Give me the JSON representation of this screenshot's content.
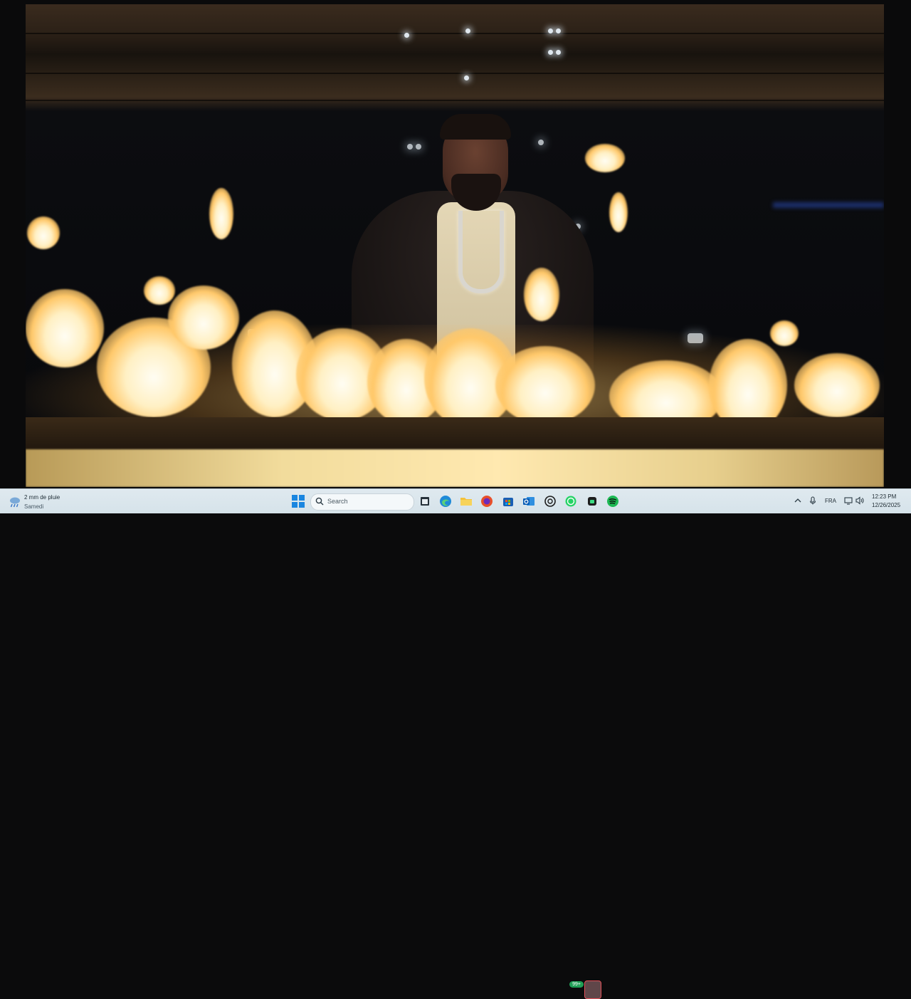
{
  "taskbar": {
    "weather": {
      "icon": "weather-rain-icon",
      "line1": "2 mm de pluie",
      "line2": "Samedi"
    },
    "search": {
      "placeholder": "Search"
    },
    "pinned_apps": [
      {
        "name": "file-explorer-icon"
      },
      {
        "name": "edge-browser-icon"
      },
      {
        "name": "folder-icon"
      },
      {
        "name": "firefox-icon"
      },
      {
        "name": "store-icon"
      },
      {
        "name": "outlook-icon"
      },
      {
        "name": "chatgpt-icon"
      },
      {
        "name": "whatsapp-icon",
        "badge": "99+"
      },
      {
        "name": "android-app-icon",
        "active": true
      },
      {
        "name": "spotify-icon"
      }
    ],
    "tray": {
      "language": "FRA",
      "time": "12:23 PM",
      "date": "12/26/2025"
    }
  },
  "colors": {
    "taskbar_bg": "#dfe9ef",
    "accent_blue": "#1a86e0",
    "whatsapp_green": "#1f9f55",
    "spotify_green": "#1db954",
    "active_highlight": "#e2525a"
  }
}
